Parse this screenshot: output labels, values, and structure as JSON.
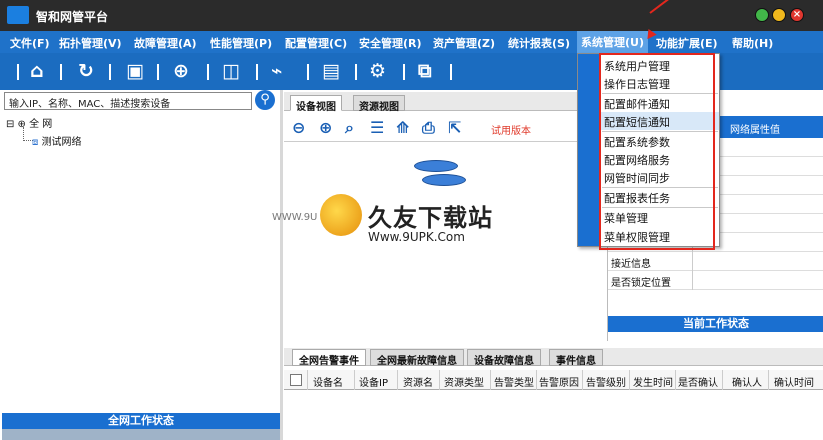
{
  "window": {
    "title": "智和网管平台"
  },
  "menu": {
    "items": [
      "文件(F)",
      "拓扑管理(V)",
      "故障管理(A)",
      "性能管理(P)",
      "配置管理(C)",
      "安全管理(R)",
      "资产管理(Z)",
      "统计报表(S)",
      "系统管理(U)",
      "功能扩展(E)",
      "帮助(H)"
    ]
  },
  "toolbar": {
    "icons": [
      "home-icon",
      "refresh-icon",
      "save-icon",
      "globe-icon",
      "device-icon",
      "chart-icon",
      "monitor-icon",
      "settings-icon",
      "window-icon"
    ]
  },
  "search": {
    "placeholder": "输入IP、名称、MAC、描述搜索设备"
  },
  "tree": {
    "root": "全 网",
    "child": "测试网络"
  },
  "left_status": "全网工作状态",
  "center_tabs": [
    "设备视图",
    "资源视图"
  ],
  "topo_tools": {
    "trial": "试用版本"
  },
  "watermark": {
    "title": "久友下载站",
    "url": "Www.9UPK.Com",
    "prefix": "WWW.9U"
  },
  "properties": {
    "header": "网络属性值",
    "rows": [
      "",
      "",
      "",
      "",
      "",
      "",
      "",
      "",
      "",
      "是否锁定位置"
    ],
    "partial_row": "接近信息"
  },
  "right_status": "当前工作状态",
  "bottom_tabs": [
    "全网告警事件",
    "全网最新故障信息",
    "设备故障信息",
    "事件信息"
  ],
  "grid_columns": [
    "设备名",
    "设备IP",
    "资源名",
    "资源类型",
    "告警类型",
    "告警原因",
    "告警级别",
    "发生时间",
    "是否确认",
    "确认人",
    "确认时间"
  ],
  "system_menu": {
    "items": [
      "系统用户管理",
      "操作日志管理",
      "配置邮件通知",
      "配置短信通知",
      "配置系统参数",
      "配置网络服务",
      "网管时间同步",
      "配置报表任务",
      "菜单管理",
      "菜单权限管理"
    ]
  },
  "colors": {
    "accent": "#1a6fd0",
    "highlight": "#e3271d"
  }
}
